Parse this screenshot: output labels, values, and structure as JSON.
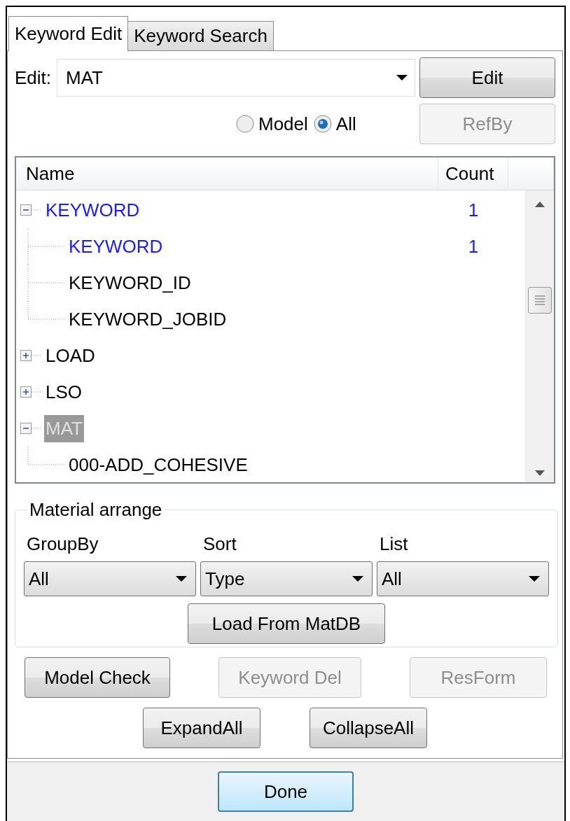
{
  "tabs": [
    {
      "label": "Keyword Edit",
      "selected": true
    },
    {
      "label": "Keyword Search",
      "selected": false
    }
  ],
  "edit": {
    "label": "Edit:",
    "value": "MAT",
    "button": "Edit"
  },
  "scope": {
    "options": [
      {
        "label": "Model",
        "selected": false
      },
      {
        "label": "All",
        "selected": true
      }
    ],
    "button": {
      "label": "RefBy",
      "disabled": true
    }
  },
  "tree": {
    "columns": [
      "Name",
      "Count"
    ],
    "items": [
      {
        "name": "KEYWORD",
        "count": "1",
        "highlighted": true,
        "expanded": true,
        "selected": false,
        "children": [
          {
            "name": "KEYWORD",
            "count": "1",
            "highlighted": true,
            "selected": false
          },
          {
            "name": "KEYWORD_ID",
            "highlighted": false,
            "selected": false
          },
          {
            "name": "KEYWORD_JOBID",
            "highlighted": false,
            "selected": false
          }
        ]
      },
      {
        "name": "LOAD",
        "highlighted": false,
        "expanded": false,
        "selected": false
      },
      {
        "name": "LSO",
        "highlighted": false,
        "expanded": false,
        "selected": false
      },
      {
        "name": "MAT",
        "highlighted": false,
        "expanded": true,
        "selected": true,
        "children": [
          {
            "name": "000-ADD_COHESIVE",
            "highlighted": false,
            "selected": false
          }
        ]
      }
    ]
  },
  "material_arrange": {
    "title": "Material arrange",
    "fields": [
      {
        "label": "GroupBy",
        "value": "All"
      },
      {
        "label": "Sort",
        "value": "Type"
      },
      {
        "label": "List",
        "value": "All"
      }
    ],
    "button": "Load From MatDB"
  },
  "actions": [
    {
      "label": "Model Check",
      "disabled": false
    },
    {
      "label": "Keyword Del",
      "disabled": true
    },
    {
      "label": "ResForm",
      "disabled": true
    }
  ],
  "tree_buttons": [
    "ExpandAll",
    "CollapseAll"
  ],
  "footer": {
    "button": "Done"
  }
}
